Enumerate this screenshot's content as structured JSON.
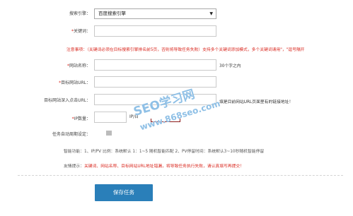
{
  "form": {
    "engine": {
      "label": "搜索引擎：",
      "value": "百度搜索引擎"
    },
    "keyword": {
      "label": "关键词：",
      "value": ""
    },
    "notice": {
      "label": "注意事项：",
      "text": "（关键词必须在目标搜索引擎排名前5页，否则将导致任务失败）支持多个关键词添加模式，多个关键词请用\"，\"逗号隔开"
    },
    "site_name": {
      "label": "网站名称：",
      "value": "",
      "hint": "30个字之内"
    },
    "site_url": {
      "label": "目标网站URL：",
      "value": ""
    },
    "deep_url": {
      "label": "目标网站深入点击URL：",
      "value": "",
      "hint": "填是目前网站URL页面里有的链接地址！"
    },
    "ip": {
      "label": "IP数量：",
      "value": "",
      "unit": "IP/日"
    },
    "period": {
      "label": "任务自动周期设定："
    },
    "smart": {
      "label": "智能功能：",
      "text": "1、IP/PV 比例：系统默认 1：1~5 随机智能匹配    2、PV停留时间：系统默认3~10秒随机智能停留"
    },
    "tip": {
      "label": "友情提示：",
      "text": "关键词、网站名称、目标网站URL地址错漏，将导致任务执行失败，请认真填写再提交！"
    },
    "save_label": "保存任务"
  },
  "watermark": {
    "line1": "SEO学习网",
    "line2": "www.868seo.com"
  },
  "colors": {
    "accent": "#2a7fb9",
    "required": "#d9251c"
  }
}
